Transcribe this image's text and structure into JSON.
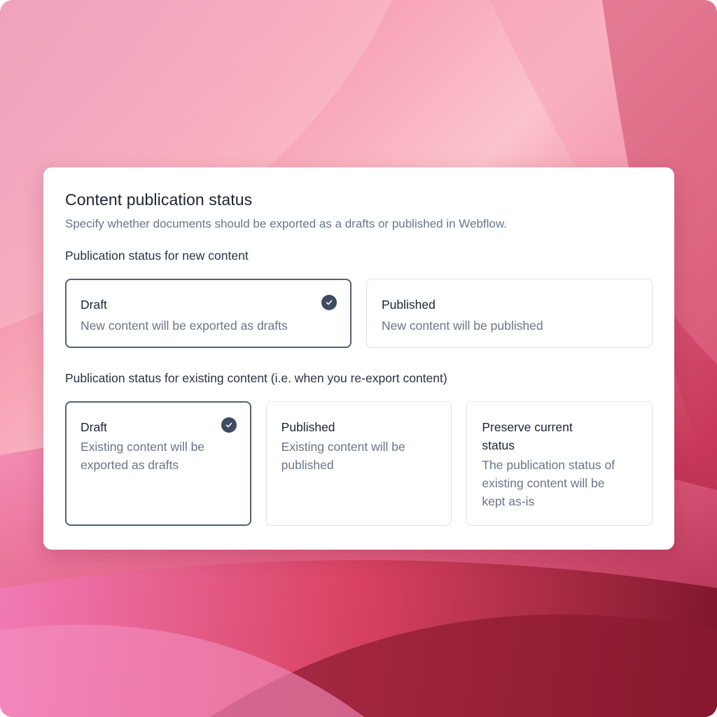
{
  "panel": {
    "title": "Content publication status",
    "subtitle": "Specify whether documents should be exported as a drafts or published in Webflow."
  },
  "new_content": {
    "label": "Publication status for new content",
    "options": [
      {
        "title": "Draft",
        "description": "New content will be exported as drafts",
        "selected": true
      },
      {
        "title": "Published",
        "description": "New content will be published",
        "selected": false
      }
    ]
  },
  "existing_content": {
    "label": "Publication status for existing content (i.e. when you re-export content)",
    "options": [
      {
        "title": "Draft",
        "description": "Existing content will be exported as drafts",
        "selected": true
      },
      {
        "title": "Published",
        "description": "Existing content will be published",
        "selected": false
      },
      {
        "title": "Preserve current status",
        "description": "The publication status of existing content will be kept as-is",
        "selected": false
      }
    ]
  },
  "icons": {
    "selected": "check-circle-icon"
  },
  "colors": {
    "selected_border": "#556070",
    "check_fill": "#3f4b5e",
    "background_accent": "#e8709a"
  }
}
